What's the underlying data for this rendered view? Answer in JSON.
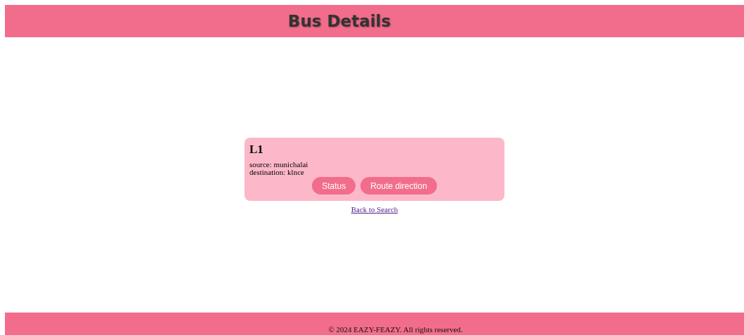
{
  "header": {
    "title": "Bus Details"
  },
  "bus": {
    "name": "L1",
    "source": "source: munichalai",
    "destination": "destination: klnce",
    "buttons": [
      "Status",
      "Route direction"
    ]
  },
  "back_link": "Back to Search",
  "footer": "© 2024 EAZY-FEAZY. All rights reserved."
}
